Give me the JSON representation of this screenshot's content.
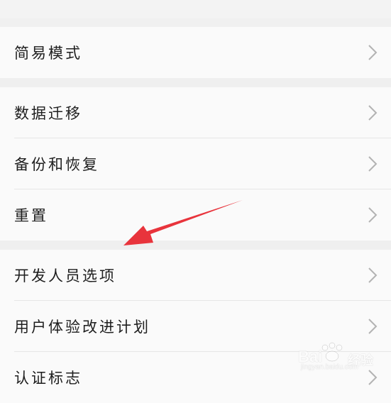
{
  "settings": {
    "group1": [
      {
        "label": "简易模式"
      }
    ],
    "group2": [
      {
        "label": "数据迁移"
      },
      {
        "label": "备份和恢复"
      },
      {
        "label": "重置"
      }
    ],
    "group3": [
      {
        "label": "开发人员选项"
      },
      {
        "label": "用户体验改进计划"
      },
      {
        "label": "认证标志"
      }
    ]
  },
  "watermark": {
    "brand": "Bai",
    "brand_cn": "经验",
    "url": "jingyan.baidu.com"
  },
  "colors": {
    "arrow": "#e8343c",
    "chevron": "#b3b3b3"
  }
}
